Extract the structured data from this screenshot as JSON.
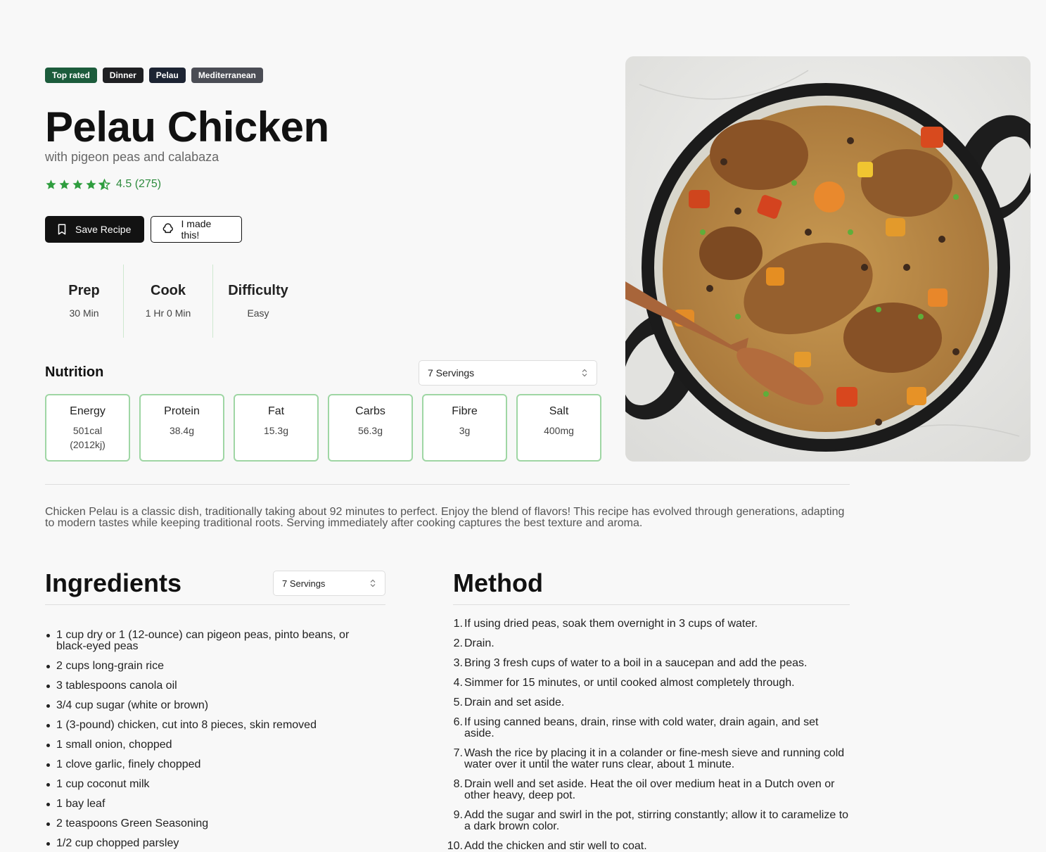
{
  "tags": [
    {
      "label": "Top rated"
    },
    {
      "label": "Dinner"
    },
    {
      "label": "Pelau"
    },
    {
      "label": "Mediterranean"
    }
  ],
  "title": "Pelau Chicken",
  "subtitle": "with pigeon peas and calabaza",
  "rating": {
    "stars": 4.5,
    "text": "4.5 (275)",
    "color": "#2e8b3e"
  },
  "actions": {
    "save_label": "Save Recipe",
    "made_label": "I made this!"
  },
  "times": [
    {
      "label": "Prep",
      "value": "30 Min"
    },
    {
      "label": "Cook",
      "value": "1 Hr 0 Min"
    },
    {
      "label": "Difficulty",
      "value": "Easy"
    }
  ],
  "nutrition": {
    "title": "Nutrition",
    "servings": "7 Servings",
    "items": [
      {
        "label": "Energy",
        "value": "501cal (2012kj)"
      },
      {
        "label": "Protein",
        "value": "38.4g"
      },
      {
        "label": "Fat",
        "value": "15.3g"
      },
      {
        "label": "Carbs",
        "value": "56.3g"
      },
      {
        "label": "Fibre",
        "value": "3g"
      },
      {
        "label": "Salt",
        "value": "400mg"
      }
    ]
  },
  "description": "Chicken Pelau is a classic dish, traditionally taking about 92 minutes to perfect. Enjoy the blend of flavors! This recipe has evolved through generations, adapting to modern tastes while keeping traditional roots. Serving immediately after cooking captures the best texture and aroma.",
  "ingredients": {
    "title": "Ingredients",
    "servings": "7 Servings",
    "items": [
      "1 cup dry or 1 (12-ounce) can pigeon peas, pinto beans, or black-eyed peas",
      "2 cups long-grain rice",
      "3 tablespoons canola oil",
      "3/4 cup sugar (white or brown)",
      "1 (3-pound) chicken, cut into 8 pieces, skin removed",
      "1 small onion, chopped",
      "1 clove garlic, finely chopped",
      "1 cup coconut milk",
      "1 bay leaf",
      "2 teaspoons Green Seasoning",
      "1/2 cup chopped parsley"
    ]
  },
  "method": {
    "title": "Method",
    "steps": [
      {
        "num": "1.",
        "text": "If using dried peas, soak them overnight in 3 cups of water."
      },
      {
        "num": "2.",
        "text": "Drain."
      },
      {
        "num": "3.",
        "text": "Bring 3 fresh cups of water to a boil in a saucepan and add the peas."
      },
      {
        "num": "4.",
        "text": "Simmer for 15 minutes, or until cooked almost completely through."
      },
      {
        "num": "5.",
        "text": "Drain and set aside."
      },
      {
        "num": "6.",
        "text": "If using canned beans, drain, rinse with cold water, drain again, and set aside."
      },
      {
        "num": "7.",
        "text": "Wash the rice by placing it in a colander or fine-mesh sieve and running cold water over it until the water runs clear, about 1 minute."
      },
      {
        "num": "8.",
        "text": "Drain well and set aside. Heat the oil over medium heat in a Dutch oven or other heavy, deep pot."
      },
      {
        "num": "9.",
        "text": "Add the sugar and swirl in the pot, stirring constantly; allow it to caramelize to a dark brown color."
      },
      {
        "num": "10.",
        "text": "Add the chicken and stir well to coat."
      }
    ]
  }
}
